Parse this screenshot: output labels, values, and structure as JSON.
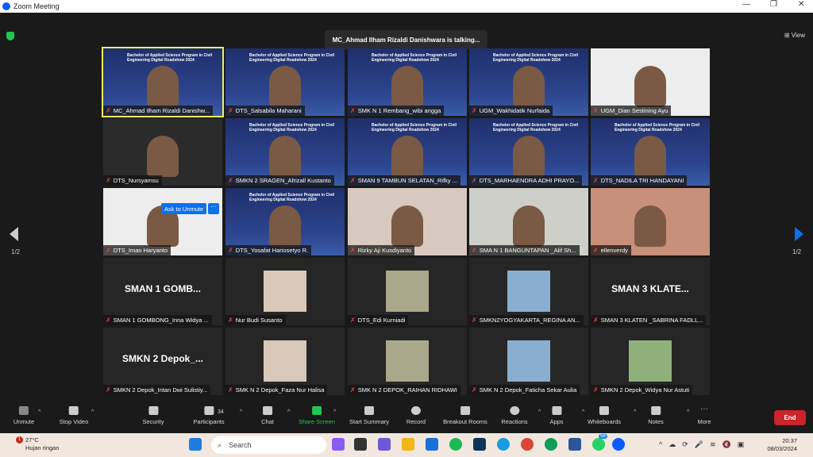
{
  "window": {
    "title": "Zoom Meeting"
  },
  "meeting": {
    "talking": "MC_Ahmad Ilham Rizaldi Danishwara is talking...",
    "view_label": "View",
    "page_left": "1/2",
    "page_right": "1/2",
    "ask_to_unmute": "Ask to Unmute",
    "ask_more": "···",
    "banner_text": "Bachelor of Applied Science Program in Civil Engineering Digital Roadshow 2024"
  },
  "participants": [
    {
      "name": "MC_Ahmad Ilham Rizaldi Danishw...",
      "type": "banner",
      "active": true
    },
    {
      "name": "DTS_Salsabila Maharani",
      "type": "banner"
    },
    {
      "name": "SMK N 1 Rembang_wibi angga",
      "type": "banner"
    },
    {
      "name": "UGM_Wakhidatik Nurfaida",
      "type": "banner"
    },
    {
      "name": "UGM_Dian Sestining Ayu",
      "type": "photo"
    },
    {
      "name": "DTS_Nursyamsu",
      "type": "photo"
    },
    {
      "name": "SMKN 2 SRAGEN_Afrizall Kustanto",
      "type": "banner"
    },
    {
      "name": "SMAN 9 TAMBUN SELATAN_Rifky ...",
      "type": "banner"
    },
    {
      "name": "DTS_MARHAENDRA ADHI PRAYO...",
      "type": "banner"
    },
    {
      "name": "DTS_NADILA TRI HANDAYANI",
      "type": "banner"
    },
    {
      "name": "DTS_Iman Haryanto",
      "type": "photo"
    },
    {
      "name": "DTS_Yosafat Hariosetyo R.",
      "type": "banner"
    },
    {
      "name": "Rizky Aji Kusdiyanto",
      "type": "photo"
    },
    {
      "name": "SMA N 1 BANGUNTAPAN _Alif Sh...",
      "type": "photo"
    },
    {
      "name": "ellenverdy",
      "type": "photo"
    },
    {
      "name": "SMAN 1 GOMBONG_Inna Widya ...",
      "type": "name",
      "display": "SMAN 1 GOMB..."
    },
    {
      "name": "Nur Budi Susanto",
      "type": "avatar"
    },
    {
      "name": "DTS_Edi Kurniadi",
      "type": "avatar"
    },
    {
      "name": "SMKN2YOGYAKARTA_REGINA AN...",
      "type": "avatar"
    },
    {
      "name": "SMAN 3 KLATEN _SABRINA FADLL...",
      "type": "name",
      "display": "SMAN 3 KLATE..."
    },
    {
      "name": "SMKN 2 Depok_Intan Dwi Sulistiy...",
      "type": "name",
      "display": "SMKN 2 Depok_..."
    },
    {
      "name": "SMK N 2 Depok_Faza Nur Halisa",
      "type": "avatar"
    },
    {
      "name": "SMK N 2 DEPOK_RAIHAN RIDHAWI",
      "type": "avatar"
    },
    {
      "name": "SMK N 2 Depok_Faticha Sekar Aulia",
      "type": "avatar"
    },
    {
      "name": "SMKN 2 Depok_Widya Nur Astuti",
      "type": "avatar"
    }
  ],
  "toolbar": {
    "unmute": "Unmute",
    "stop_video": "Stop Video",
    "security": "Security",
    "participants": "Participants",
    "participants_count": "34",
    "chat": "Chat",
    "share_screen": "Share Screen",
    "start_summary": "Start Summary",
    "record": "Record",
    "breakout_rooms": "Breakout Rooms",
    "reactions": "Reactions",
    "apps": "Apps",
    "whiteboards": "Whiteboards",
    "notes": "Notes",
    "more": "More",
    "end": "End"
  },
  "taskbar": {
    "temp": "27°C",
    "weather": "Hujan ringan",
    "weather_badge": "1",
    "search": "Search",
    "time": "20:37",
    "date": "08/03/2024",
    "whatsapp_badge": "56"
  },
  "colors": {
    "active_speaker": "#e9f06a",
    "share": "#23c552",
    "end": "#c8262a",
    "accent": "#0e71eb"
  }
}
